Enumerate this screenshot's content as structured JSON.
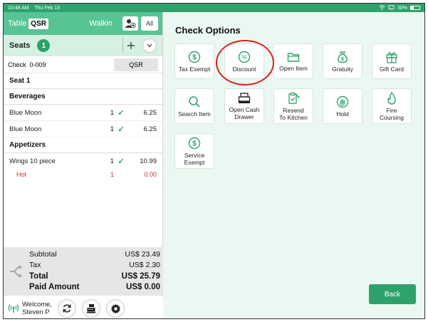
{
  "status_bar": {
    "time": "10:48 AM",
    "date": "Thu Feb 13",
    "battery": "30%"
  },
  "order_header": {
    "table_label": "Table",
    "table_value": "QSR",
    "customer": "Walkin",
    "all_label": "All"
  },
  "seats": {
    "label": "Seats",
    "count": "1"
  },
  "check": {
    "label": "Check",
    "number": "0-009",
    "type": "QSR"
  },
  "seat_heading": "Seat 1",
  "categories": [
    {
      "name": "Beverages",
      "items": [
        {
          "name": "Blue Moon",
          "qty": "1",
          "price": "6.25"
        },
        {
          "name": "Blue Moon",
          "qty": "1",
          "price": "6.25"
        }
      ]
    },
    {
      "name": "Appetizers",
      "items": [
        {
          "name": "Wings 10 piece",
          "qty": "1",
          "price": "10.99"
        }
      ],
      "modifier": {
        "name": "Hot",
        "qty": "1",
        "price": "0.00"
      }
    }
  ],
  "totals": {
    "subtotal_label": "Subtotal",
    "subtotal": "US$ 23.49",
    "tax_label": "Tax",
    "tax": "US$ 2.30",
    "total_label": "Total",
    "total": "US$ 25.79",
    "paid_label": "Paid Amount",
    "paid": "US$ 0.00"
  },
  "footer": {
    "welcome": "Welcome,",
    "user": "Steven P"
  },
  "check_options": {
    "title": "Check Options",
    "tiles": {
      "tax_exempt": "Tax Exempt",
      "discount": "Discount",
      "open_item": "Open Item",
      "gratuity": "Gratuity",
      "gift_card": "Gift Card",
      "search_item": "Search Item",
      "open_cash_drawer_1": "Open Cash",
      "open_cash_drawer_2": "Drawer",
      "resend_1": "Resend",
      "resend_2": "To Kitchen",
      "hold": "Hold",
      "fire_1": "Fire",
      "fire_2": "Coursing",
      "service_exempt_1": "Service",
      "service_exempt_2": "Exempt"
    },
    "back_label": "Back"
  },
  "colors": {
    "accent": "#2ea26a",
    "header_green": "#58c494",
    "panel_bg": "#eaf8f1",
    "modifier_red": "#c0322f",
    "annotation_red": "#e02020"
  }
}
